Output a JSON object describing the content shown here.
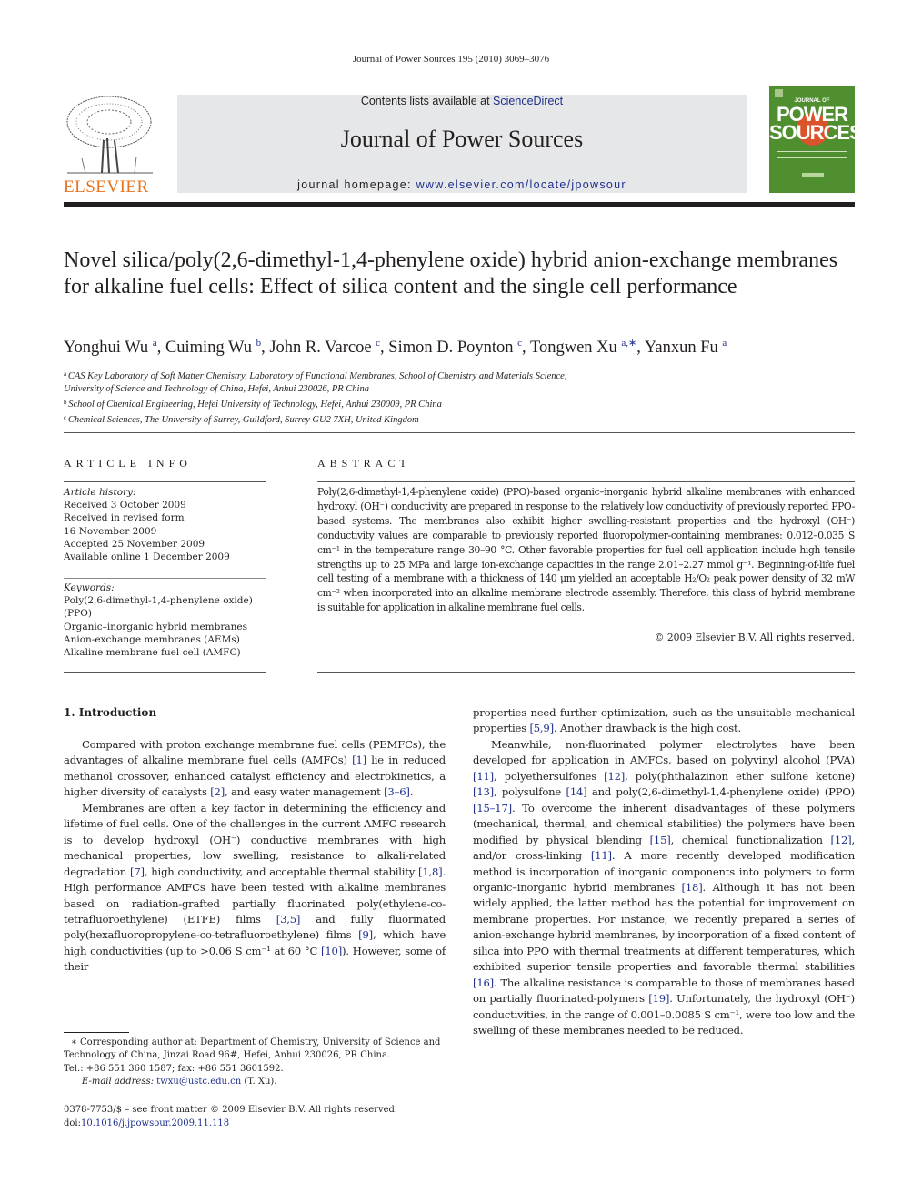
{
  "running_head": "Journal of Power Sources 195 (2010) 3069–3076",
  "banner": {
    "contents_prefix": "Contents lists available at ",
    "contents_link": "ScienceDirect",
    "journal_title": "Journal of Power Sources",
    "homepage_prefix": "journal homepage: ",
    "homepage_link": "www.elsevier.com/locate/jpowsour"
  },
  "publisher_logo_text": "ELSEVIER",
  "cover": {
    "line1": "JOURNAL OF",
    "line2": "POWER",
    "line3": "SOURCES",
    "colors": {
      "background": "#4f8f2f",
      "sun": "#d9532b"
    }
  },
  "article": {
    "title": "Novel silica/poly(2,6-dimethyl-1,4-phenylene oxide) hybrid anion-exchange membranes for alkaline fuel cells: Effect of silica content and the single cell performance",
    "authors": [
      {
        "name": "Yonghui Wu",
        "sup": "a"
      },
      {
        "name": "Cuiming Wu",
        "sup": "b"
      },
      {
        "name": "John R. Varcoe",
        "sup": "c"
      },
      {
        "name": "Simon D. Poynton",
        "sup": "c"
      },
      {
        "name": "Tongwen Xu",
        "sup": "a,∗"
      },
      {
        "name": "Yanxun Fu",
        "sup": "a"
      }
    ],
    "affiliations": [
      {
        "sup": "a",
        "line1": "CAS Key Laboratory of Soft Matter Chemistry, Laboratory of Functional Membranes, School of Chemistry and Materials Science,",
        "line2": "University of Science and Technology of China, Hefei, Anhui 230026, PR China"
      },
      {
        "sup": "b",
        "line1": "School of Chemical Engineering, Hefei University of Technology, Hefei, Anhui 230009, PR China"
      },
      {
        "sup": "c",
        "line1": "Chemical Sciences, The University of Surrey, Guildford, Surrey GU2 7XH, United Kingdom"
      }
    ]
  },
  "article_info": {
    "heading": "ARTICLE INFO",
    "history_label": "Article history:",
    "history": [
      "Received 3 October 2009",
      "Received in revised form",
      "16 November 2009",
      "Accepted 25 November 2009",
      "Available online 1 December 2009"
    ],
    "keywords_label": "Keywords:",
    "keywords": [
      "Poly(2,6-dimethyl-1,4-phenylene oxide)",
      "(PPO)",
      "Organic–inorganic hybrid membranes",
      "Anion-exchange membranes (AEMs)",
      "Alkaline membrane fuel cell (AMFC)"
    ]
  },
  "abstract": {
    "heading": "ABSTRACT",
    "text": "Poly(2,6-dimethyl-1,4-phenylene oxide) (PPO)-based organic–inorganic hybrid alkaline membranes with enhanced hydroxyl (OH⁻) conductivity are prepared in response to the relatively low conductivity of previously reported PPO-based systems. The membranes also exhibit higher swelling-resistant properties and the hydroxyl (OH⁻) conductivity values are comparable to previously reported fluoropolymer-containing membranes: 0.012–0.035 S cm⁻¹ in the temperature range 30–90 °C. Other favorable properties for fuel cell application include high tensile strengths up to 25 MPa and large ion-exchange capacities in the range 2.01–2.27 mmol g⁻¹. Beginning-of-life fuel cell testing of a membrane with a thickness of 140 μm yielded an acceptable H₂/O₂ peak power density of 32 mW cm⁻² when incorporated into an alkaline membrane electrode assembly. Therefore, this class of hybrid membrane is suitable for application in alkaline membrane fuel cells.",
    "copyright": "© 2009 Elsevier B.V. All rights reserved."
  },
  "introduction": {
    "heading": "1.  Introduction",
    "col1": [
      [
        {
          "t": "Compared with proton exchange membrane fuel cells (PEMFCs), the advantages of alkaline membrane fuel cells (AMFCs) "
        },
        {
          "t": "[1]",
          "ref": true
        },
        {
          "t": " lie in reduced methanol crossover, enhanced catalyst efficiency and electrokinetics, a higher diversity of catalysts "
        },
        {
          "t": "[2]",
          "ref": true
        },
        {
          "t": ", and easy water management "
        },
        {
          "t": "[3–6]",
          "ref": true
        },
        {
          "t": "."
        }
      ],
      [
        {
          "t": "Membranes are often a key factor in determining the efficiency and lifetime of fuel cells. One of the challenges in the current AMFC research is to develop hydroxyl (OH⁻) conductive membranes with high mechanical properties, low swelling, resistance to alkali-related degradation "
        },
        {
          "t": "[7]",
          "ref": true
        },
        {
          "t": ", high conductivity, and acceptable thermal stability "
        },
        {
          "t": "[1,8]",
          "ref": true
        },
        {
          "t": ". High performance AMFCs have been tested with alkaline membranes based on radiation-grafted partially fluorinated poly(ethylene-co-tetrafluoroethylene) (ETFE) films "
        },
        {
          "t": "[3,5]",
          "ref": true
        },
        {
          "t": " and fully fluorinated poly(hexafluoropropylene-co-tetrafluoroethylene) films "
        },
        {
          "t": "[9]",
          "ref": true
        },
        {
          "t": ", which have high conductivities (up to >0.06 S cm⁻¹ at 60 °C "
        },
        {
          "t": "[10]",
          "ref": true
        },
        {
          "t": "). However, some of their"
        }
      ]
    ],
    "col2": [
      [
        {
          "t": "properties need further optimization, such as the unsuitable mechanical properties "
        },
        {
          "t": "[5,9]",
          "ref": true
        },
        {
          "t": ". Another drawback is the high cost."
        }
      ],
      [
        {
          "t": "Meanwhile, non-fluorinated polymer electrolytes have been developed for application in AMFCs, based on polyvinyl alcohol (PVA) "
        },
        {
          "t": "[11]",
          "ref": true
        },
        {
          "t": ", polyethersulfones "
        },
        {
          "t": "[12]",
          "ref": true
        },
        {
          "t": ", poly(phthalazinon ether sulfone ketone) "
        },
        {
          "t": "[13]",
          "ref": true
        },
        {
          "t": ", polysulfone "
        },
        {
          "t": "[14]",
          "ref": true
        },
        {
          "t": " and poly(2,6-dimethyl-1,4-phenylene oxide) (PPO) "
        },
        {
          "t": "[15–17]",
          "ref": true
        },
        {
          "t": ". To overcome the inherent disadvantages of these polymers (mechanical, thermal, and chemical stabilities) the polymers have been modified by physical blending "
        },
        {
          "t": "[15]",
          "ref": true
        },
        {
          "t": ", chemical functionalization "
        },
        {
          "t": "[12]",
          "ref": true
        },
        {
          "t": ", and/or cross-linking "
        },
        {
          "t": "[11]",
          "ref": true
        },
        {
          "t": ". A more recently developed modification method is incorporation of inorganic components into polymers to form organic–inorganic hybrid membranes "
        },
        {
          "t": "[18]",
          "ref": true
        },
        {
          "t": ". Although it has not been widely applied, the latter method has the potential for improvement on membrane properties. For instance, we recently prepared a series of anion-exchange hybrid membranes, by incorporation of a fixed content of silica into PPO with thermal treatments at different temperatures, which exhibited superior tensile properties and favorable thermal stabilities "
        },
        {
          "t": "[16]",
          "ref": true
        },
        {
          "t": ". The alkaline resistance is comparable to those of membranes based on partially fluorinated-polymers "
        },
        {
          "t": "[19]",
          "ref": true
        },
        {
          "t": ". Unfortunately, the hydroxyl (OH⁻) conductivities, in the range of 0.001–0.0085 S cm⁻¹, were too low and the swelling of these membranes needed to be reduced."
        }
      ]
    ]
  },
  "footnote": {
    "corresponding": "∗  Corresponding author at: Department of Chemistry, University of Science and Technology of China, Jinzai Road 96#, Hefei, Anhui 230026, PR China.",
    "tel": "Tel.: +86 551 360 1587; fax: +86 551 3601592.",
    "email_label": "E-mail address: ",
    "email": "twxu@ustc.edu.cn",
    "email_suffix": " (T. Xu)."
  },
  "front_matter": {
    "issn_line": "0378-7753/$ – see front matter © 2009 Elsevier B.V. All rights reserved.",
    "doi_label": "doi:",
    "doi": "10.1016/j.jpowsour.2009.11.118"
  },
  "colors": {
    "link": "#1f2f8c",
    "banner_bg": "#e6e7e8",
    "elsevier_orange": "#e8731c"
  }
}
